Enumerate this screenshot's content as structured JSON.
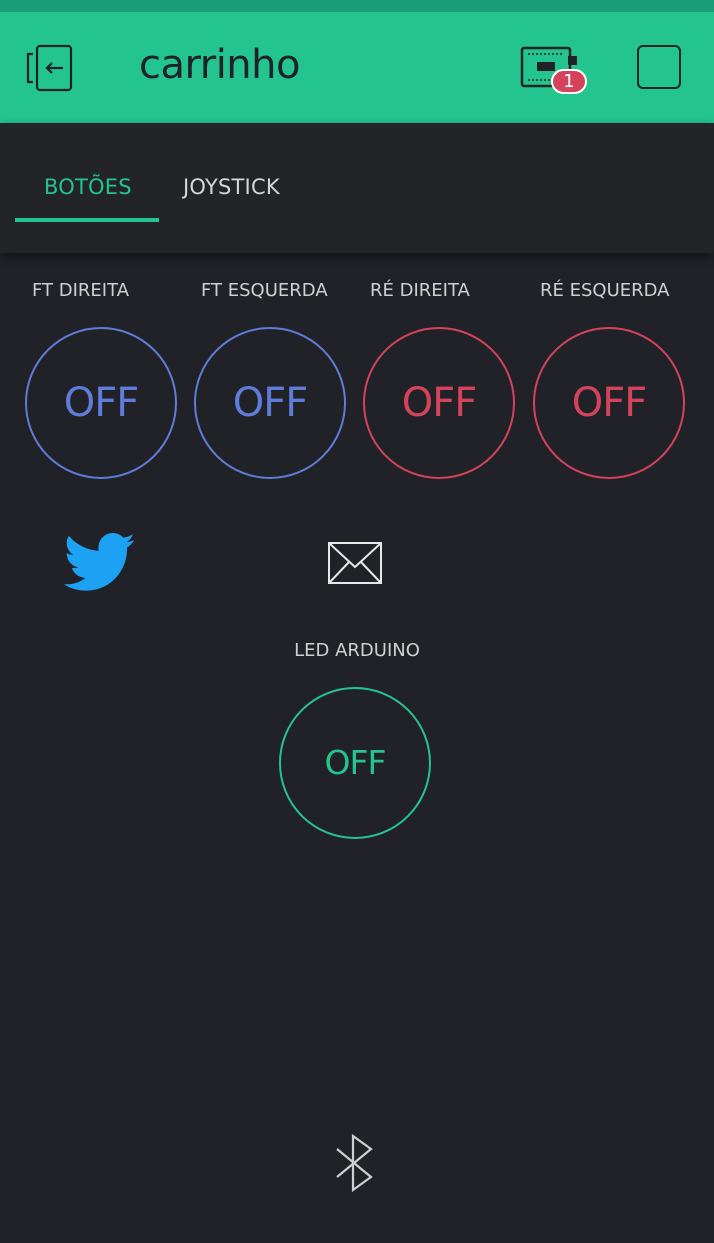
{
  "header": {
    "title": "carrinho",
    "device_badge": "1",
    "back_icon": "exit-icon",
    "device_icon": "device-board-icon",
    "stop_icon": "stop-icon"
  },
  "tabs": [
    {
      "label": "BOTÕES",
      "active": true
    },
    {
      "label": "JOYSTICK",
      "active": false
    }
  ],
  "buttons": [
    {
      "label": "FT DIREITA",
      "state": "OFF",
      "color": "#5f7cd8"
    },
    {
      "label": "FT ESQUERDA",
      "state": "OFF",
      "color": "#5f7cd8"
    },
    {
      "label": "RÉ DIREITA",
      "state": "OFF",
      "color": "#d3435c"
    },
    {
      "label": "RÉ ESQUERDA",
      "state": "OFF",
      "color": "#d3435c"
    }
  ],
  "widgets": {
    "twitter_icon": "twitter-icon",
    "email_icon": "email-icon",
    "bluetooth_icon": "bluetooth-icon"
  },
  "led": {
    "label": "LED ARDUINO",
    "state": "OFF",
    "color": "#23c48e"
  },
  "colors": {
    "accent": "#23c48e",
    "background": "#212227",
    "blue": "#5f7cd8",
    "red": "#d3435c",
    "twitter": "#1da1f2"
  }
}
